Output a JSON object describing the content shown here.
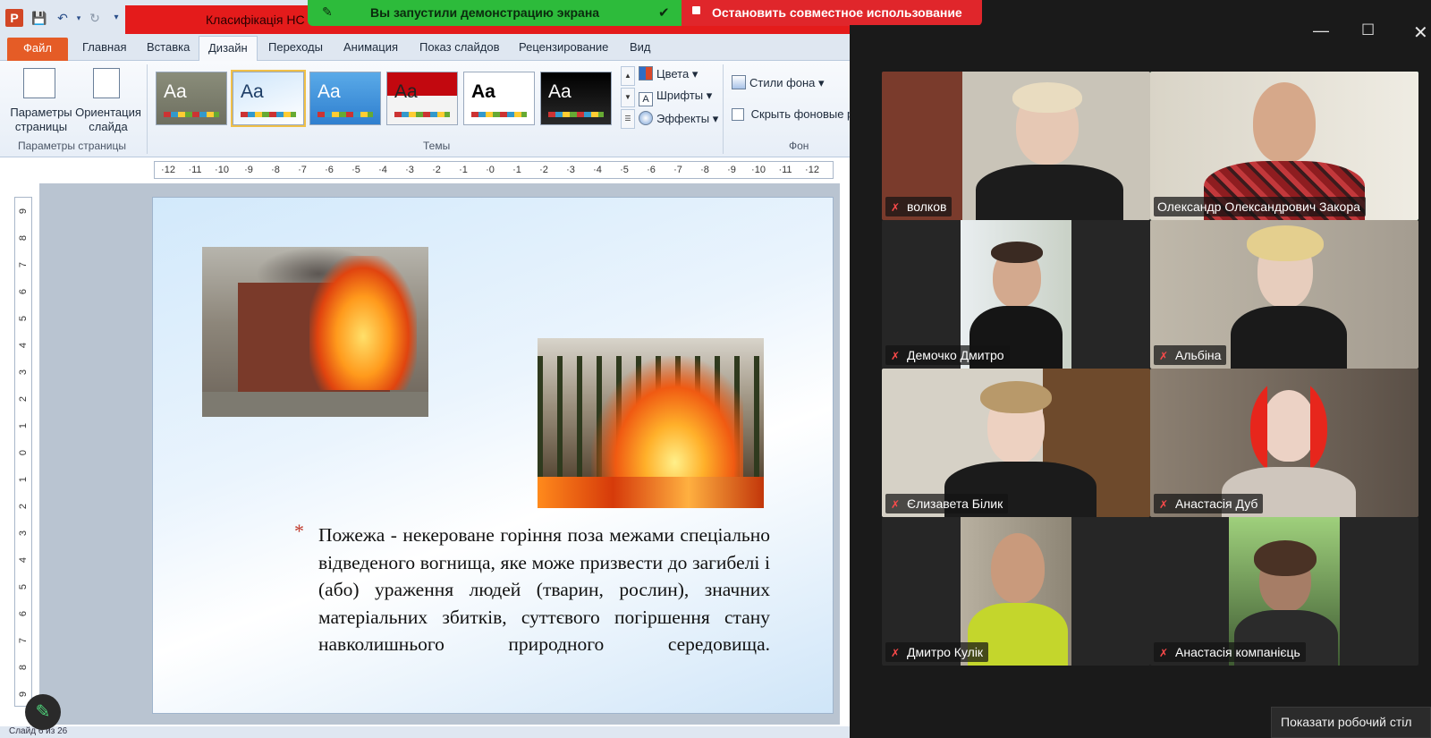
{
  "window": {
    "title": "Класифікація НС",
    "share_banner": {
      "sharing_text": "Вы запустили демонстрацию экрана",
      "stop_text": "Остановить совместное использование"
    }
  },
  "ribbon": {
    "tabs": [
      "Файл",
      "Главная",
      "Вставка",
      "Дизайн",
      "Переходы",
      "Анимация",
      "Показ слайдов",
      "Рецензирование",
      "Вид"
    ],
    "active_tab": "Дизайн",
    "page_setup": {
      "page_params_label": "Параметры страницы",
      "orientation_label": "Ориентация слайда",
      "group_label": "Параметры страницы"
    },
    "themes": {
      "group_label": "Темы",
      "thumb_text": "Aa",
      "colors_label": "Цвета",
      "fonts_label": "Шрифты",
      "effects_label": "Эффекты"
    },
    "background": {
      "styles_label": "Стили фона",
      "hide_label": "Скрыть фоновые р",
      "group_label": "Фон"
    }
  },
  "ruler": {
    "horizontal": [
      "12",
      "11",
      "10",
      "9",
      "8",
      "7",
      "6",
      "5",
      "4",
      "3",
      "2",
      "1",
      "0",
      "1",
      "2",
      "3",
      "4",
      "5",
      "6",
      "7",
      "8",
      "9",
      "10",
      "11",
      "12"
    ],
    "vertical": [
      "9",
      "8",
      "7",
      "6",
      "5",
      "4",
      "3",
      "2",
      "1",
      "0",
      "1",
      "2",
      "3",
      "4",
      "5",
      "6",
      "7",
      "8",
      "9"
    ]
  },
  "slide": {
    "definition": "Пожежа - некероване горіння поза межами спеціально відведеного вогнища, яке може призвести до загибелі і (або) ураження людей (тварин, рослин), значних матеріальних збитків, суттєвого погіршення стану навколишнього природного середовища."
  },
  "statusbar": {
    "text": "Слайд 6 из 26"
  },
  "meeting": {
    "participants": [
      {
        "name": "волков",
        "muted": true,
        "active": false
      },
      {
        "name": "Олександр Олександрович Закора",
        "muted": false,
        "active": true
      },
      {
        "name": "Демочко Дмитро",
        "muted": true,
        "active": false
      },
      {
        "name": "Альбіна",
        "muted": true,
        "active": false
      },
      {
        "name": "Єлизавета Білик",
        "muted": true,
        "active": false
      },
      {
        "name": "Анастасія Дуб",
        "muted": true,
        "active": false
      },
      {
        "name": "Дмитро Кулік",
        "muted": true,
        "active": false
      },
      {
        "name": "Анастасія компанієць",
        "muted": true,
        "active": false
      }
    ],
    "show_desktop_label": "Показати робочий стіл"
  },
  "icons": {
    "muted_mic": "muted-mic-icon",
    "pencil": "pencil-icon"
  },
  "colors": {
    "share_green": "#2dbb3b",
    "share_red": "#e0262b",
    "active_speaker": "#26d07c",
    "file_tab": "#e55c26"
  }
}
